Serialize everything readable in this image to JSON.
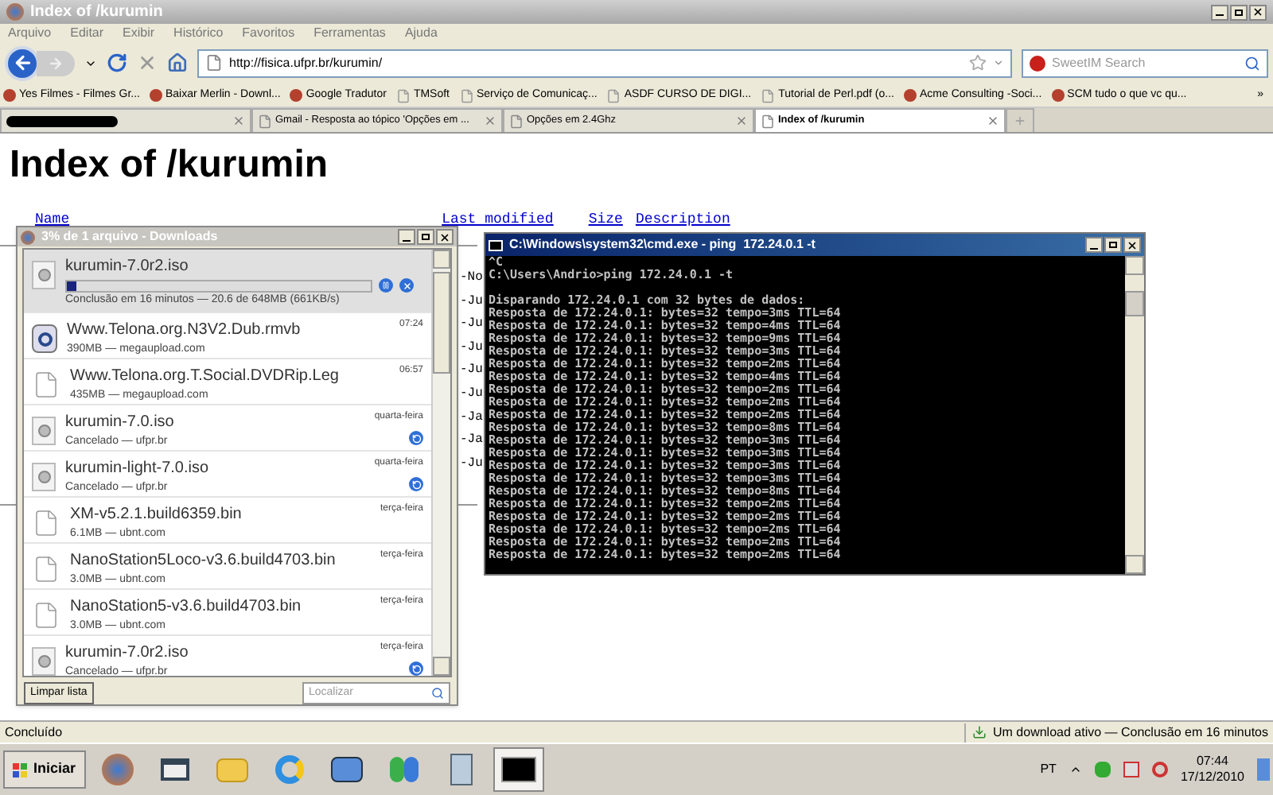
{
  "window": {
    "title": "Index of /kurumin"
  },
  "menu": [
    "Arquivo",
    "Editar",
    "Exibir",
    "Histórico",
    "Favoritos",
    "Ferramentas",
    "Ajuda"
  ],
  "address": {
    "value": "http://fisica.ufpr.br/kurumin/"
  },
  "search": {
    "placeholder": "SweetIM Search"
  },
  "bookmarks": [
    {
      "label": "Yes Filmes - Filmes Gr...",
      "kind": "site"
    },
    {
      "label": "Baixar Merlin - Downl...",
      "kind": "site"
    },
    {
      "label": "Google Tradutor",
      "kind": "site"
    },
    {
      "label": "TMSoft",
      "kind": "page"
    },
    {
      "label": "Serviço de Comunicaç...",
      "kind": "page"
    },
    {
      "label": "ASDF CURSO DE DIGI...",
      "kind": "page"
    },
    {
      "label": "Tutorial de Perl.pdf (o...",
      "kind": "page"
    },
    {
      "label": "Acme Consulting -Soci...",
      "kind": "site"
    },
    {
      "label": "SCM tudo o que vc qu...",
      "kind": "site"
    }
  ],
  "bookmarks_more": "»",
  "tabs": [
    {
      "kind": "redacted",
      "selected": false
    },
    {
      "kind": "page",
      "title": "Gmail - Resposta ao tópico 'Opções em ...",
      "selected": false
    },
    {
      "kind": "page",
      "title": "Opções em 2.4Ghz",
      "selected": false
    },
    {
      "kind": "page",
      "title": "Index of /kurumin",
      "selected": true
    }
  ],
  "page": {
    "heading": "Index of /kurumin",
    "columns": [
      "Name",
      "Last modified",
      "Size",
      "Description"
    ],
    "listing_fragments": [
      "-No",
      "-Ju",
      "-Ju",
      "-Ju",
      "-Ju",
      "-Ju",
      "-Ja",
      "-Ja",
      "-Ju"
    ]
  },
  "downloads": {
    "title": "3% de 1 arquivo - Downloads",
    "items": [
      {
        "name": "kurumin-7.0r2.iso",
        "info": "Conclusão em 16 minutos — 20.6 de 648MB (661KB/s)",
        "kind": "disc",
        "canceled": false,
        "level": 0.03,
        "selected": true
      },
      {
        "name": "Www.Telona.org.N3V2.Dub.rmvb",
        "info": "390MB — megaupload.com",
        "time": "07:24",
        "kind": "media",
        "canceled": false,
        "selected": false
      },
      {
        "name": "Www.Telona.org.T.Social.DVDRip.Leg",
        "info": "435MB — megaupload.com",
        "time": "06:57",
        "kind": "file",
        "canceled": false,
        "selected": false
      },
      {
        "name": "kurumin-7.0.iso",
        "info": "Cancelado — ufpr.br",
        "time": "quarta-feira",
        "kind": "disc",
        "canceled": true,
        "selected": false
      },
      {
        "name": "kurumin-light-7.0.iso",
        "info": "Cancelado — ufpr.br",
        "time": "quarta-feira",
        "kind": "disc",
        "canceled": true,
        "selected": false
      },
      {
        "name": "XM-v5.2.1.build6359.bin",
        "info": "6.1MB — ubnt.com",
        "time": "terça-feira",
        "kind": "file",
        "canceled": false,
        "selected": false
      },
      {
        "name": "NanoStation5Loco-v3.6.build4703.bin",
        "info": "3.0MB — ubnt.com",
        "time": "terça-feira",
        "kind": "file",
        "canceled": false,
        "selected": false
      },
      {
        "name": "NanoStation5-v3.6.build4703.bin",
        "info": "3.0MB — ubnt.com",
        "time": "terça-feira",
        "kind": "file",
        "canceled": false,
        "selected": false
      },
      {
        "name": "kurumin-7.0r2.iso",
        "info": "Cancelado — ufpr.br",
        "time": "terça-feira",
        "kind": "disc",
        "canceled": true,
        "selected": false
      }
    ],
    "clear_button": "Limpar lista",
    "find_placeholder": "Localizar"
  },
  "console": {
    "title": "C:\\Windows\\system32\\cmd.exe - ping  172.24.0.1 -t",
    "prompt_lines": [
      "^C",
      "C:\\Users\\Andrio>ping 172.24.0.1 -t"
    ],
    "lines": [
      "Disparando 172.24.0.1 com 32 bytes de dados:",
      "Resposta de 172.24.0.1: bytes=32 tempo=3ms TTL=64",
      "Resposta de 172.24.0.1: bytes=32 tempo=4ms TTL=64",
      "Resposta de 172.24.0.1: bytes=32 tempo=9ms TTL=64",
      "Resposta de 172.24.0.1: bytes=32 tempo=3ms TTL=64",
      "Resposta de 172.24.0.1: bytes=32 tempo=2ms TTL=64",
      "Resposta de 172.24.0.1: bytes=32 tempo=4ms TTL=64",
      "Resposta de 172.24.0.1: bytes=32 tempo=2ms TTL=64",
      "Resposta de 172.24.0.1: bytes=32 tempo=2ms TTL=64",
      "Resposta de 172.24.0.1: bytes=32 tempo=2ms TTL=64",
      "Resposta de 172.24.0.1: bytes=32 tempo=8ms TTL=64",
      "Resposta de 172.24.0.1: bytes=32 tempo=3ms TTL=64",
      "Resposta de 172.24.0.1: bytes=32 tempo=3ms TTL=64",
      "Resposta de 172.24.0.1: bytes=32 tempo=3ms TTL=64",
      "Resposta de 172.24.0.1: bytes=32 tempo=3ms TTL=64",
      "Resposta de 172.24.0.1: bytes=32 tempo=8ms TTL=64",
      "Resposta de 172.24.0.1: bytes=32 tempo=2ms TTL=64",
      "Resposta de 172.24.0.1: bytes=32 tempo=2ms TTL=64",
      "Resposta de 172.24.0.1: bytes=32 tempo=2ms TTL=64",
      "Resposta de 172.24.0.1: bytes=32 tempo=2ms TTL=64",
      "Resposta de 172.24.0.1: bytes=32 tempo=2ms TTL=64"
    ]
  },
  "status_bar": {
    "left": "Concluído",
    "right": "Um download ativo — Conclusão em 16 minutos"
  },
  "taskbar": {
    "start": "Iniciar",
    "apps": [
      {
        "kind": "firefox",
        "selected": false
      },
      {
        "kind": "window",
        "selected": false
      },
      {
        "kind": "folder",
        "selected": false
      },
      {
        "kind": "ie",
        "selected": false
      },
      {
        "kind": "network",
        "selected": false
      },
      {
        "kind": "messenger",
        "selected": false
      },
      {
        "kind": "calculator",
        "selected": false
      },
      {
        "kind": "console",
        "selected": true
      }
    ],
    "language": "PT",
    "time": "07:44",
    "date": "17/12/2010"
  }
}
